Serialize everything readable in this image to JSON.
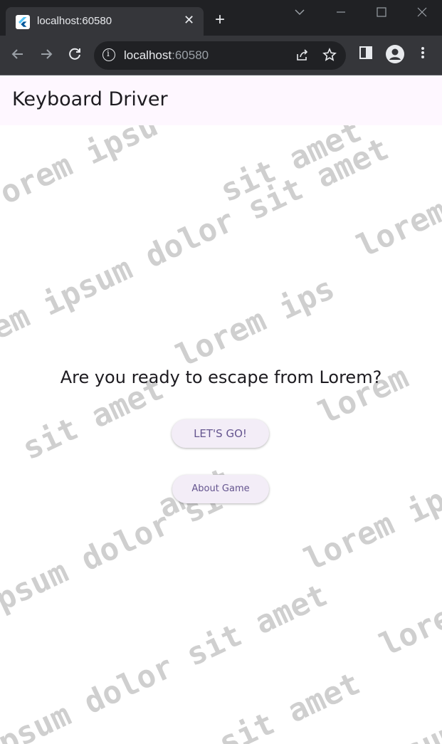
{
  "browser": {
    "tab_title": "localhost:60580",
    "url_host": "localhost",
    "url_port": ":60580",
    "close_glyph": "✕",
    "new_tab_glyph": "+"
  },
  "app": {
    "title": "Keyboard Driver",
    "question": "Are you ready to escape from Lorem?",
    "primary_button": "LET'S GO!",
    "secondary_button": "About Game",
    "watermark": {
      "words": [
        "lorem",
        "ipsum",
        "dolor",
        "sit",
        "amet"
      ],
      "lines": [
        "orem ipsu",
        "sit amet",
        "rem ipsum dolor sit amet",
        "lorem ipsum dolor",
        "em ipsum dolor sit amet",
        "lorem ips",
        "lorem ipsum dolor sit amet",
        "sit amet",
        "amet",
        "lorem ipsu",
        "psum dolor sit",
        "psum dolor sit amet",
        "lorem",
        "psum dolor sit",
        "sit amet",
        "sum"
      ]
    }
  },
  "colors": {
    "appbar_bg": "#fef7ff",
    "button_bg": "#f3edf7",
    "button_text": "#65558f",
    "watermark": "#cfcfcf",
    "chrome_dark": "#202124"
  }
}
